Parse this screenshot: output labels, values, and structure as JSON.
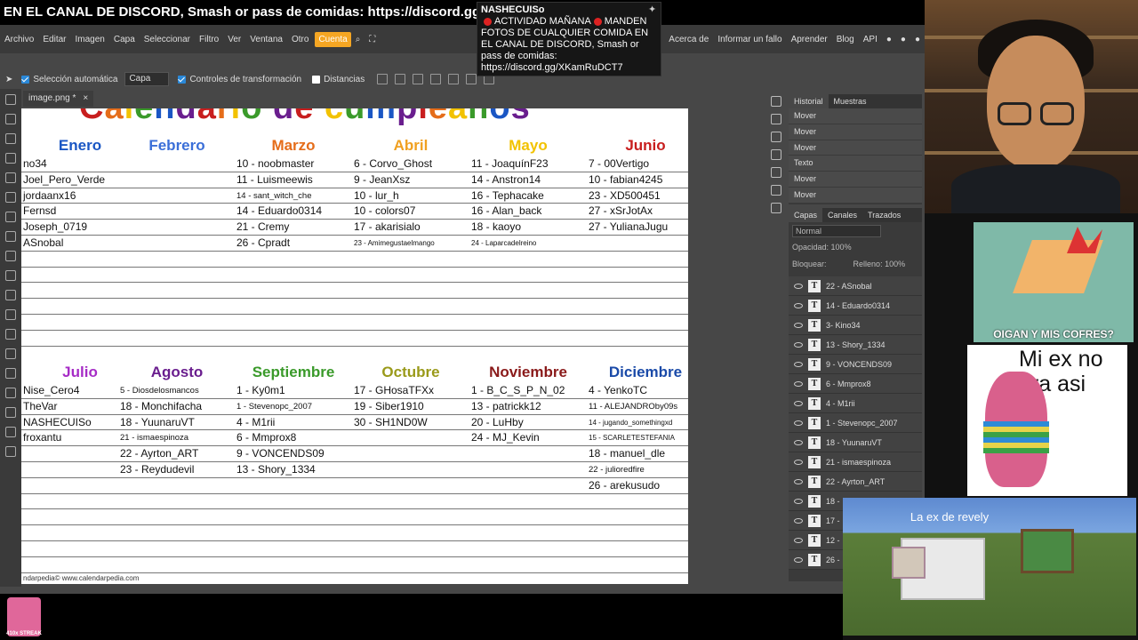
{
  "banner": {
    "text": "EN EL CANAL DE DISCORD, Smash or pass de comidas: https://discord.gg/XKam"
  },
  "chat": {
    "user": "NASHECUISo",
    "line1": "ACTIVIDAD MAÑANA",
    "line1b": "MANDEN",
    "body": "FOTOS DE CUALQUIER COMIDA EN EL CANAL DE DISCORD, Smash or pass de comidas:",
    "link": "https://discord.gg/XKamRuDCT7"
  },
  "menu": {
    "items": [
      "Archivo",
      "Editar",
      "Imagen",
      "Capa",
      "Seleccionar",
      "Filtro",
      "Ver",
      "Ventana",
      "Otro"
    ],
    "cuenta": "Cuenta",
    "right": [
      "Acerca de",
      "Informar un fallo",
      "Aprender",
      "Blog",
      "API"
    ]
  },
  "options": {
    "auto_select": "Selección automática",
    "layer_select": "Capa",
    "transform": "Controles de transformación",
    "distances": "Distancias"
  },
  "tab": {
    "name": "image.png *",
    "close": "×"
  },
  "calendar": {
    "title_partial": "Calendario de cumpleaños",
    "footer": "ndarpedia©   www.calendarpedia.com",
    "months": [
      {
        "name": "Enero",
        "color": "#1a56c4",
        "entries": [
          "no34",
          "Joel_Pero_Verde",
          "jordaanx16",
          "Fernsd",
          "Joseph_0719",
          "ASnobal",
          "",
          "",
          "",
          "",
          "",
          ""
        ]
      },
      {
        "name": "Febrero",
        "color": "#3b6fd8",
        "entries": [
          "",
          "",
          "",
          "",
          "",
          "",
          "",
          "",
          "",
          "",
          "",
          ""
        ]
      },
      {
        "name": "Marzo",
        "color": "#e56d1a",
        "entries": [
          "10 - noobmaster",
          "11 - Luismeewis",
          "14 - sant_witch_che",
          "14 - Eduardo0314",
          "21 - Cremy",
          "26 - Cpradt",
          "",
          "",
          "",
          "",
          "",
          ""
        ]
      },
      {
        "name": "Abril",
        "color": "#f0a020",
        "entries": [
          "6 - Corvo_Ghost",
          "9 - JeanXsz",
          "10 - lur_h",
          "10 - colors07",
          "17 - akarisialo",
          "23 - Amimegustaelmango",
          "",
          "",
          "",
          "",
          "",
          ""
        ]
      },
      {
        "name": "Mayo",
        "color": "#f2c200",
        "entries": [
          "11 - JoaquínF23",
          "14 - Anstron14",
          "16 - Tephacake",
          "16 - Alan_back",
          "18 - kaoyo",
          "24 - Laparcadelreino",
          "",
          "",
          "",
          "",
          "",
          ""
        ]
      },
      {
        "name": "Junio",
        "color": "#c81e1e",
        "entries": [
          "7 - 00Vertigo",
          "10 - fabian4245",
          "23 - XD500451",
          "27 - xSrJotAx",
          "27 - YulianaJugu",
          "",
          "",
          "",
          "",
          "",
          "",
          ""
        ]
      },
      {
        "name": "Julio",
        "color": "#a62cc6",
        "entries": [
          "Nise_Cero4",
          "TheVar",
          "NASHECUISo",
          "froxantu",
          "",
          "",
          "",
          "",
          "",
          "",
          "",
          ""
        ]
      },
      {
        "name": "Agosto",
        "color": "#6a1e8e",
        "entries": [
          "5 - Diosdelosmancos",
          "18 - Monchifacha",
          "18 - YuunaruVT",
          "21 - ismaespinoza",
          "22 - Ayrton_ART",
          "23 - Reydudevil",
          "",
          "",
          "",
          "",
          "",
          ""
        ]
      },
      {
        "name": "Septiembre",
        "color": "#3a9a2a",
        "entries": [
          "1 - Ky0m1",
          "1 - Stevenopc_2007",
          "4 - M1rii",
          "6 - Mmprox8",
          "9 - VONCENDS09",
          "13 - Shory_1334",
          "",
          "",
          "",
          "",
          "",
          ""
        ]
      },
      {
        "name": "Octubre",
        "color": "#9a9a1a",
        "entries": [
          "17 - GHosaTFXx",
          "19 - Siber1910",
          "30 - SH1ND0W",
          "",
          "",
          "",
          "",
          "",
          "",
          "",
          "",
          ""
        ]
      },
      {
        "name": "Noviembre",
        "color": "#8a1a1a",
        "entries": [
          "1 - B_C_S_P_N_02",
          "13 - patrickk12",
          "20 - LuHby",
          "24 - MJ_Kevin",
          "",
          "",
          "",
          "",
          "",
          "",
          "",
          ""
        ]
      },
      {
        "name": "Diciembre",
        "color": "#1a4aa8",
        "entries": [
          "4 - YenkoTC",
          "11 - ALEJANDROby09s",
          "14 - jugando_somethingxd",
          "15 - SCARLETESTEFANIA",
          "18 - manuel_dle",
          "22 - julioredfire",
          "26 - arekusudo",
          "",
          "",
          "",
          "",
          ""
        ]
      }
    ]
  },
  "history": {
    "tabs": [
      "Historial",
      "Muestras"
    ],
    "rows": [
      "Mover",
      "Mover",
      "Mover",
      "Texto",
      "Mover",
      "Mover"
    ]
  },
  "layers": {
    "tabs": [
      "Capas",
      "Canales",
      "Trazados"
    ],
    "blend": "Normal",
    "opacity_label": "Opacidad:",
    "opacity": "100%",
    "lock_label": "Bloquear:",
    "fill_label": "Relleno:",
    "fill": "100%",
    "rows": [
      "22 - ASnobal",
      "14 - Eduardo0314",
      "3- Kino34",
      "13 - Shory_1334",
      "9 - VONCENDS09",
      "6 - Mmprox8",
      "4 - M1rii",
      "1 - Stevenopc_2007",
      "18 - YuunaruVT",
      "21 - ismaespinoza",
      "22 - Ayrton_ART",
      "18 -",
      "17 -",
      "12 -",
      "26 -"
    ]
  },
  "memes": {
    "meme1": "OIGAN Y MIS COFRES?",
    "meme2": "Mi ex no era asi",
    "meme3": "La ex de revely"
  },
  "streak": "410x STREAK"
}
